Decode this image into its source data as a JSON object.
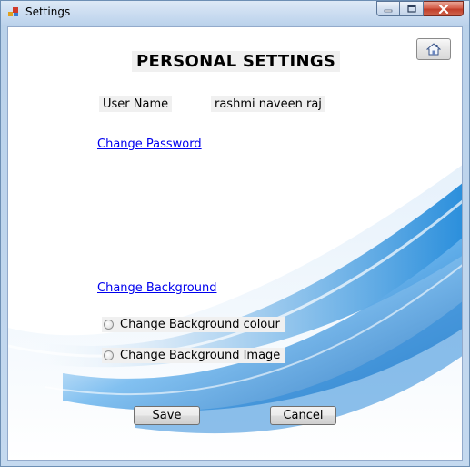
{
  "window": {
    "title": "Settings",
    "controls": {
      "minimize": "minimize-icon",
      "maximize": "maximize-icon",
      "close": "close-icon"
    }
  },
  "header": {
    "title": "PERSONAL SETTINGS",
    "home_icon": "home-icon"
  },
  "user": {
    "label": "User Name",
    "value": "rashmi naveen raj"
  },
  "links": {
    "change_password": "Change Password",
    "change_background": "Change Background"
  },
  "background_options": [
    {
      "label": "Change Background colour",
      "selected": false
    },
    {
      "label": "Change Background Image",
      "selected": false
    }
  ],
  "buttons": {
    "save": "Save",
    "cancel": "Cancel"
  },
  "colors": {
    "link": "#0000ee",
    "accent_blue": "#1c7fd4",
    "label_bg": "#f0f0f0"
  }
}
